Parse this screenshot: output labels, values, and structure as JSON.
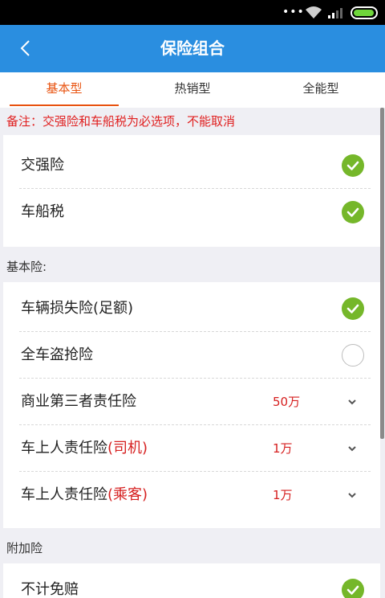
{
  "app": {
    "title": "保险组合"
  },
  "tabs": [
    {
      "label": "基本型"
    },
    {
      "label": "热销型"
    },
    {
      "label": "全能型"
    }
  ],
  "note": "备注：交强险和车船税为必选项，不能取消",
  "required_items": [
    {
      "label": "交强险",
      "checked": true
    },
    {
      "label": "车船税",
      "checked": true
    }
  ],
  "basic_section": {
    "title": "基本险:",
    "items": [
      {
        "label": "车辆损失险(足额)",
        "checked": true
      },
      {
        "label": "全车盗抢险",
        "checked": false
      },
      {
        "label": "商业第三者责任险",
        "value": "50万"
      },
      {
        "label": "车上人责任险",
        "label_suffix": "(司机)",
        "value": "1万"
      },
      {
        "label": "车上人责任险",
        "label_suffix": "(乘客)",
        "value": "1万"
      }
    ]
  },
  "addon_section": {
    "title": "附加险",
    "items": [
      {
        "label": "不计免赔",
        "checked": true
      }
    ]
  },
  "colors": {
    "accent": "#2a8ee0",
    "tab_active": "#e8520f",
    "check": "#75b72a",
    "red": "#d62020"
  }
}
